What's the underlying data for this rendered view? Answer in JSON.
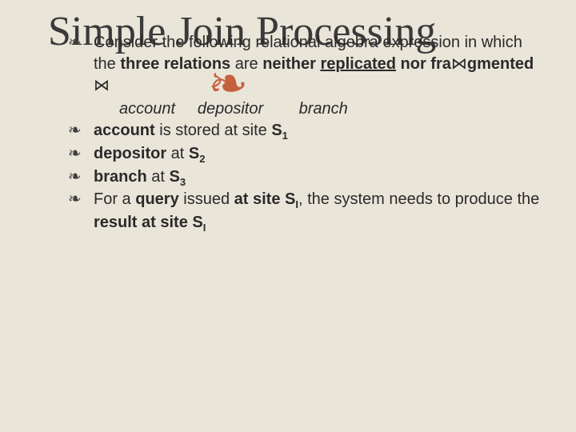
{
  "title": "Simple Join Processing",
  "bullets": [
    {
      "pre": "Consider the following relational algebra expression in which the ",
      "bold1": "three relations",
      "mid1": " are ",
      "bold2": "neither ",
      "underlined": "replicated",
      "bold3_part1": " nor fra",
      "bold3_part2": "gmented ",
      "rel1": "account",
      "rel2": "depositor",
      "rel3": "branch"
    },
    {
      "b": "account",
      "t": "  is stored at site ",
      "s_lbl": "S",
      "s_sub": "1"
    },
    {
      "b": "depositor",
      "t": " at ",
      "s_lbl": "S",
      "s_sub": "2"
    },
    {
      "b": "branch",
      "t": " at ",
      "s_lbl": "S",
      "s_sub": "3"
    },
    {
      "p1": "For a ",
      "b1": "query",
      "p2": " issued ",
      "b2": "at site S",
      "sub1": "I",
      "p3": ", the system needs to produce the ",
      "b3": "result at site S",
      "sub2": "I"
    }
  ],
  "flourish": "❧",
  "bullet_glyph": "❧",
  "join_glyph": "⋈"
}
